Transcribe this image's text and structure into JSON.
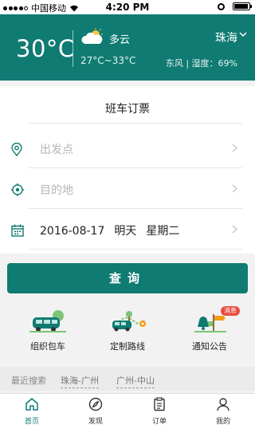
{
  "status_bar": {
    "carrier": "中国移动",
    "time": "4:20 PM"
  },
  "weather": {
    "temperature": "30°C",
    "condition": "多云",
    "range": "27°C~33°C",
    "city": "珠海",
    "wind_humidity": "东风 | 湿度：69%"
  },
  "booking": {
    "title": "班车订票",
    "departure_placeholder": "出发点",
    "destination_placeholder": "目的地",
    "date": "2016-08-17",
    "day_label": "明天",
    "weekday": "星期二"
  },
  "search_button": "查询",
  "features": [
    {
      "label": "组织包车",
      "icon": "bus-icon"
    },
    {
      "label": "定制路线",
      "icon": "route-icon"
    },
    {
      "label": "通知公告",
      "icon": "announcement-icon",
      "badge": "消息"
    }
  ],
  "recent": {
    "label": "最近搜索",
    "items": [
      "珠海-广州",
      "广州-中山"
    ]
  },
  "tabs": [
    {
      "label": "首页",
      "icon": "home-icon",
      "active": true
    },
    {
      "label": "发现",
      "icon": "compass-icon",
      "active": false
    },
    {
      "label": "订单",
      "icon": "clipboard-icon",
      "active": false
    },
    {
      "label": "我的",
      "icon": "profile-icon",
      "active": false
    }
  ],
  "colors": {
    "primary": "#0f7b72",
    "badge": "#e84c3d"
  }
}
